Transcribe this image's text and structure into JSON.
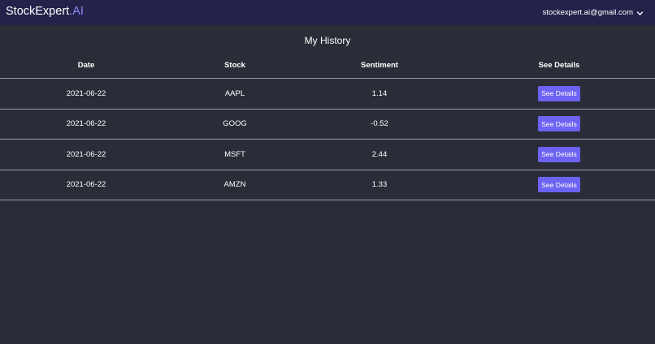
{
  "navbar": {
    "brand_main": "StockExpert",
    "brand_accent": ".AI",
    "account_email": "stockexpert.ai@gmail.com",
    "account_icon": "chevron-down-icon"
  },
  "page": {
    "title": "My History"
  },
  "table": {
    "columns": [
      "Date",
      "Stock",
      "Sentiment",
      "See Details"
    ],
    "rows": [
      {
        "date": "2021-06-22",
        "stock": "AAPL",
        "sentiment": "1.14",
        "action": "See Details"
      },
      {
        "date": "2021-06-22",
        "stock": "GOOG",
        "sentiment": "-0.52",
        "action": "See Details"
      },
      {
        "date": "2021-06-22",
        "stock": "MSFT",
        "sentiment": "2.44",
        "action": "See Details"
      },
      {
        "date": "2021-06-22",
        "stock": "AMZN",
        "sentiment": "1.33",
        "action": "See Details"
      }
    ]
  },
  "colors": {
    "background": "#2a2d37",
    "navbar": "#24224a",
    "accent": "#8b8cf5",
    "button": "#6d63f2",
    "divider": "#9a9ca3"
  }
}
